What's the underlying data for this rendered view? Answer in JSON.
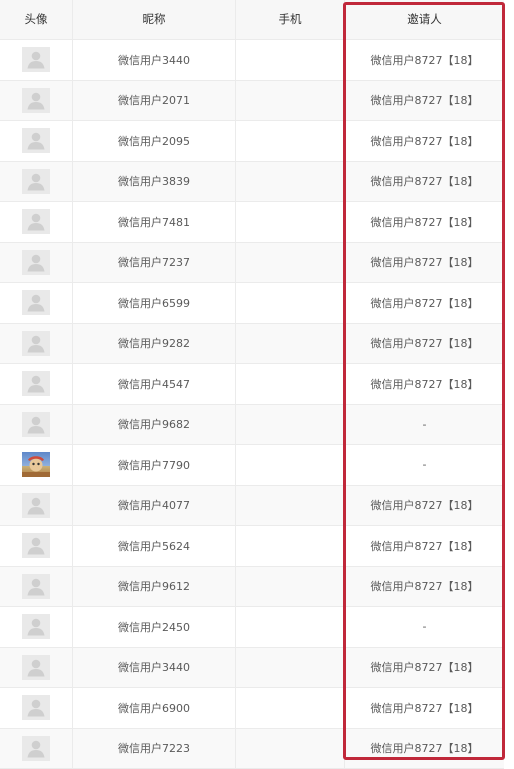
{
  "columns": {
    "avatar": "头像",
    "nickname": "昵称",
    "phone": "手机",
    "inviter": "邀请人"
  },
  "rows": [
    {
      "avatar": "default-avatar-icon",
      "nickname": "微信用户3440",
      "phone": "",
      "inviter": "微信用户8727【18】"
    },
    {
      "avatar": "default-avatar-icon",
      "nickname": "微信用户2071",
      "phone": "",
      "inviter": "微信用户8727【18】"
    },
    {
      "avatar": "default-avatar-icon",
      "nickname": "微信用户2095",
      "phone": "",
      "inviter": "微信用户8727【18】"
    },
    {
      "avatar": "default-avatar-icon",
      "nickname": "微信用户3839",
      "phone": "",
      "inviter": "微信用户8727【18】"
    },
    {
      "avatar": "default-avatar-icon",
      "nickname": "微信用户7481",
      "phone": "",
      "inviter": "微信用户8727【18】"
    },
    {
      "avatar": "default-avatar-icon",
      "nickname": "微信用户7237",
      "phone": "",
      "inviter": "微信用户8727【18】"
    },
    {
      "avatar": "default-avatar-icon",
      "nickname": "微信用户6599",
      "phone": "",
      "inviter": "微信用户8727【18】"
    },
    {
      "avatar": "default-avatar-icon",
      "nickname": "微信用户9282",
      "phone": "",
      "inviter": "微信用户8727【18】"
    },
    {
      "avatar": "default-avatar-icon",
      "nickname": "微信用户4547",
      "phone": "",
      "inviter": "微信用户8727【18】"
    },
    {
      "avatar": "default-avatar-icon",
      "nickname": "微信用户9682",
      "phone": "",
      "inviter": "-"
    },
    {
      "avatar": "user-photo-avatar",
      "nickname": "微信用户7790",
      "phone": "",
      "inviter": "-"
    },
    {
      "avatar": "default-avatar-icon",
      "nickname": "微信用户4077",
      "phone": "",
      "inviter": "微信用户8727【18】"
    },
    {
      "avatar": "default-avatar-icon",
      "nickname": "微信用户5624",
      "phone": "",
      "inviter": "微信用户8727【18】"
    },
    {
      "avatar": "default-avatar-icon",
      "nickname": "微信用户9612",
      "phone": "",
      "inviter": "微信用户8727【18】"
    },
    {
      "avatar": "default-avatar-icon",
      "nickname": "微信用户2450",
      "phone": "",
      "inviter": "-"
    },
    {
      "avatar": "default-avatar-icon",
      "nickname": "微信用户3440",
      "phone": "",
      "inviter": "微信用户8727【18】"
    },
    {
      "avatar": "default-avatar-icon",
      "nickname": "微信用户6900",
      "phone": "",
      "inviter": "微信用户8727【18】"
    },
    {
      "avatar": "default-avatar-icon",
      "nickname": "微信用户7223",
      "phone": "",
      "inviter": "微信用户8727【18】"
    }
  ],
  "colors": {
    "highlight_border": "#c0283a",
    "header_bg": "#f7f7f7",
    "row_alt_bg": "#f9f9f9",
    "grid_line": "#ebebeb"
  }
}
